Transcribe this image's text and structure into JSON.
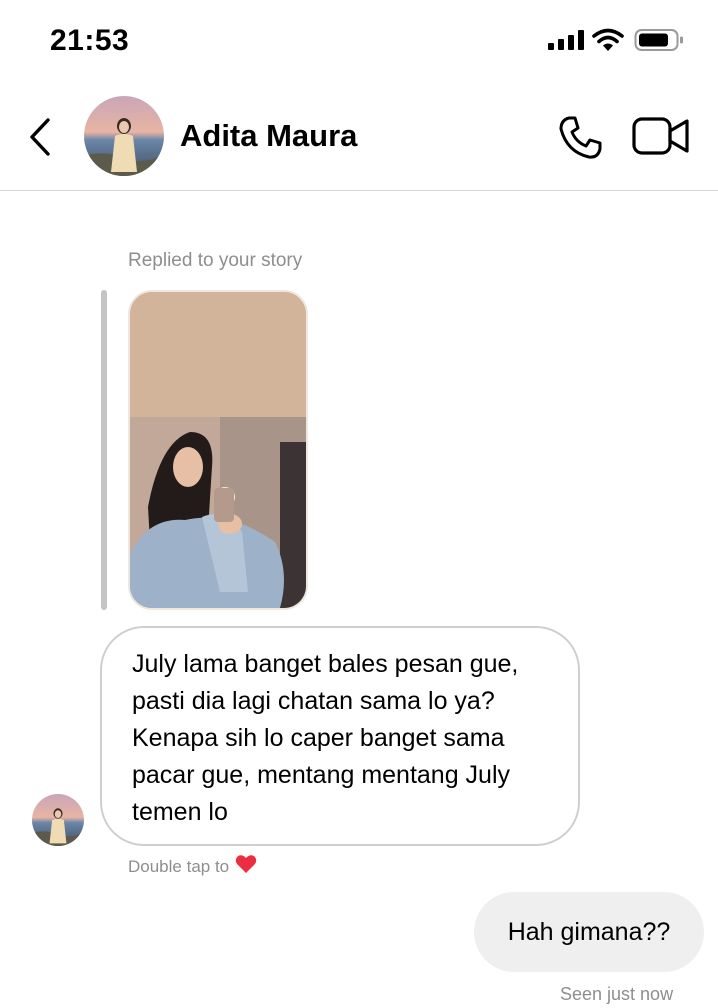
{
  "status_bar": {
    "time": "21:53",
    "signal_icon": "signal-bars-icon",
    "wifi_icon": "wifi-icon",
    "battery_icon": "battery-icon"
  },
  "header": {
    "back_icon": "chevron-left-icon",
    "contact_name": "Adita Maura",
    "avatar": "contact-avatar",
    "call_icon": "phone-icon",
    "video_icon": "video-camera-icon"
  },
  "conversation": {
    "story_reply": {
      "label": "Replied to your story",
      "thumbnail": "story-thumbnail"
    },
    "incoming_message": "July lama banget bales pesan gue,\npasti dia lagi chatan sama lo ya?\nKenapa sih lo caper banget sama\npacar gue, mentang mentang July\ntemen lo",
    "reaction_hint": {
      "text": "Double tap to",
      "icon": "heart-icon",
      "color": "#ed2e40"
    },
    "outgoing_message": "Hah gimana??",
    "seen_status": "Seen just now"
  },
  "colors": {
    "secondary_text": "#8e8e8e",
    "outgoing_bubble": "#efefef",
    "incoming_border": "#cfcfcf"
  }
}
